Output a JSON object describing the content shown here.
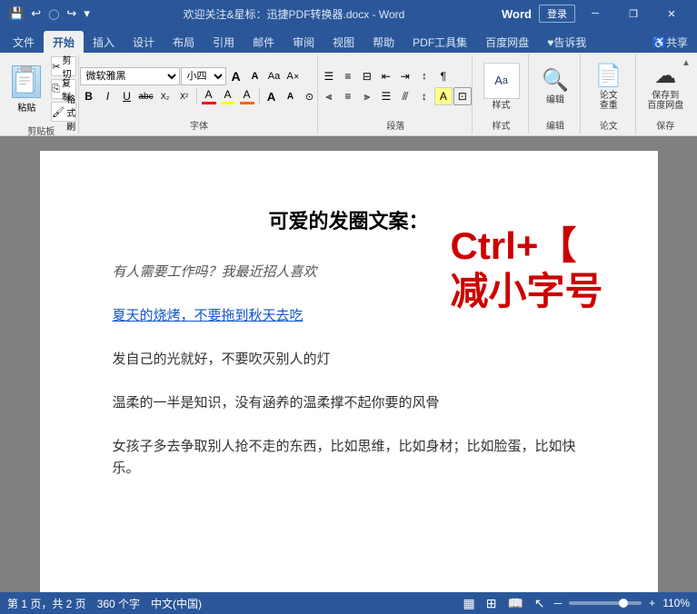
{
  "titlebar": {
    "title": "欢迎关注&星标：迅捷PDF转换器.docx - Word",
    "login": "登录",
    "word_label": "Word",
    "buttons": {
      "minimize": "─",
      "restore": "❐",
      "close": "✕"
    }
  },
  "quick_access": {
    "save": "💾",
    "undo": "↩",
    "redo": "↪",
    "dropdown": "▾"
  },
  "tabs": [
    {
      "label": "文件",
      "active": false
    },
    {
      "label": "开始",
      "active": true
    },
    {
      "label": "插入",
      "active": false
    },
    {
      "label": "设计",
      "active": false
    },
    {
      "label": "布局",
      "active": false
    },
    {
      "label": "引用",
      "active": false
    },
    {
      "label": "邮件",
      "active": false
    },
    {
      "label": "审阅",
      "active": false
    },
    {
      "label": "视图",
      "active": false
    },
    {
      "label": "帮助",
      "active": false
    },
    {
      "label": "PDF工具集",
      "active": false
    },
    {
      "label": "百度网盘",
      "active": false
    },
    {
      "label": "♥告诉我",
      "active": false
    },
    {
      "label": "♿共享",
      "active": false
    }
  ],
  "ribbon": {
    "groups": {
      "clipboard": {
        "label": "剪贴板",
        "paste_label": "粘贴",
        "cut_label": "剪切",
        "copy_label": "复制",
        "format_painter": "格式刷"
      },
      "font": {
        "label": "字体",
        "font_name": "微软雅黑",
        "font_size": "小四",
        "bold": "B",
        "italic": "I",
        "underline": "U",
        "strikethrough": "abc",
        "subscript": "X₂",
        "superscript": "X²",
        "clear_format": "A",
        "increase_size": "A",
        "decrease_size": "A",
        "font_color_label": "A",
        "highlight_label": "A"
      },
      "paragraph": {
        "label": "段落"
      },
      "style": {
        "label": "样式"
      },
      "edit": {
        "label": "编辑"
      },
      "thesis": {
        "label": "论文",
        "check_label": "论文\n查重"
      },
      "save": {
        "label": "保存",
        "baidu_label": "保存到\n百度网盘"
      }
    }
  },
  "document": {
    "title": "可爱的发圈文案：",
    "paragraphs": [
      {
        "text": "有人需要工作吗？我最近招人喜欢",
        "style": "italic"
      },
      {
        "text": "夏天的烧烤，不要拖到秋天去吃",
        "style": "underline"
      },
      {
        "text": "发自己的光就好，不要吹灭别人的灯",
        "style": "normal"
      },
      {
        "text": "温柔的一半是知识，没有涵养的温柔撑不起你要的风骨",
        "style": "normal"
      },
      {
        "text": "女孩子多去争取别人抢不走的东西，比如思维，比如身材；比如脸蛋，比如快乐。",
        "style": "normal"
      }
    ],
    "shortcut_line1": "Ctrl+【",
    "shortcut_line2": "减小字号"
  },
  "statusbar": {
    "page_info": "第 1 页，共 2 页",
    "word_count": "360 个字",
    "language": "中文(中国)",
    "zoom": "110%",
    "zoom_minus": "─",
    "zoom_plus": "+"
  }
}
